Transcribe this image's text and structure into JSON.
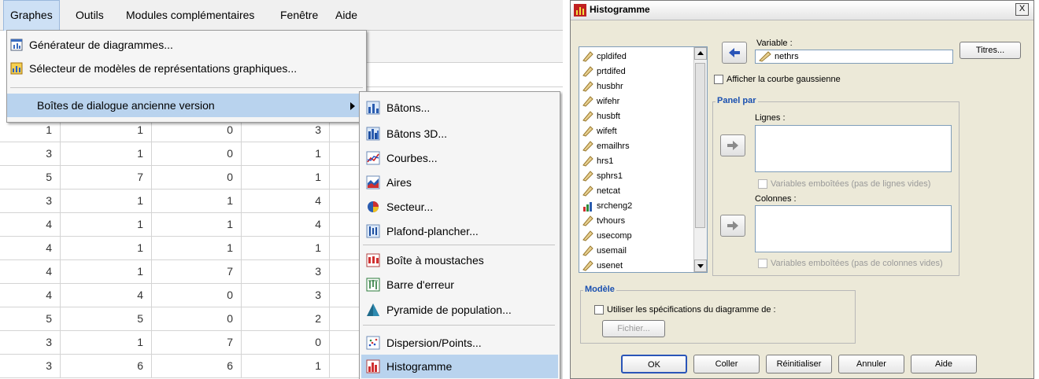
{
  "menubar": {
    "items": [
      {
        "label": "Graphes"
      },
      {
        "label": "Outils"
      },
      {
        "label": "Modules complémentaires"
      },
      {
        "label": "Fenêtre"
      },
      {
        "label": "Aide"
      }
    ]
  },
  "graph_menu": {
    "items": [
      {
        "label": "Générateur de diagrammes...",
        "icon": "chart-builder-icon"
      },
      {
        "label": "Sélecteur de modèles de représentations graphiques...",
        "icon": "template-chooser-icon"
      },
      {
        "label": "Boîtes de dialogue ancienne version",
        "icon": ""
      }
    ]
  },
  "sub_menu": {
    "items": [
      {
        "label": "Bâtons...",
        "icon": "bar-chart-icon"
      },
      {
        "label": "Bâtons 3D...",
        "icon": "bar-3d-icon"
      },
      {
        "label": "Courbes...",
        "icon": "line-chart-icon"
      },
      {
        "label": "Aires",
        "icon": "area-chart-icon"
      },
      {
        "label": "Secteur...",
        "icon": "pie-chart-icon"
      },
      {
        "label": "Plafond-plancher...",
        "icon": "high-low-icon"
      },
      {
        "label": "Boîte à moustaches",
        "icon": "boxplot-icon"
      },
      {
        "label": "Barre d'erreur",
        "icon": "error-bar-icon"
      },
      {
        "label": "Pyramide de population...",
        "icon": "population-pyramid-icon"
      },
      {
        "label": "Dispersion/Points...",
        "icon": "scatter-icon"
      },
      {
        "label": "Histogramme",
        "icon": "histogram-icon"
      }
    ],
    "selected": "Histogramme"
  },
  "grid": {
    "rows": [
      [
        "1",
        "1",
        "0",
        "3"
      ],
      [
        "3",
        "1",
        "0",
        "1"
      ],
      [
        "5",
        "7",
        "0",
        "1"
      ],
      [
        "3",
        "1",
        "1",
        "4"
      ],
      [
        "4",
        "1",
        "1",
        "4"
      ],
      [
        "4",
        "1",
        "1",
        "1"
      ],
      [
        "4",
        "1",
        "7",
        "3"
      ],
      [
        "4",
        "4",
        "0",
        "3"
      ],
      [
        "5",
        "5",
        "0",
        "2"
      ],
      [
        "3",
        "1",
        "7",
        "0"
      ],
      [
        "3",
        "6",
        "6",
        "1"
      ]
    ]
  },
  "dialog": {
    "title": "Histogramme",
    "close": "X",
    "variables": [
      "cpldifed",
      "prtdifed",
      "husbhr",
      "wifehr",
      "husbft",
      "wifeft",
      "emailhrs",
      "hrs1",
      "sphrs1",
      "netcat",
      "srcheng2",
      "tvhours",
      "usecomp",
      "usemail",
      "usenet"
    ],
    "variable_label": "Variable :",
    "variable_value": "nethrs",
    "titles_button": "Titres...",
    "normal_curve_label": "Afficher la courbe gaussienne",
    "panel_title": "Panel par",
    "rows_label": "Lignes :",
    "rows_nested_label": "Variables emboîtées (pas de lignes vides)",
    "cols_label": "Colonnes :",
    "cols_nested_label": "Variables emboîtées (pas de colonnes vides)",
    "model_title": "Modèle",
    "model_checkbox_label": "Utiliser les spécifications du diagramme de :",
    "file_button": "Fichier...",
    "ok": "OK",
    "paste": "Coller",
    "reset": "Réinitialiser",
    "cancel": "Annuler",
    "help": "Aide"
  },
  "colors": {
    "highlight": "#b9d3ee",
    "dialog_bg": "#ece9d8",
    "group_title": "#1a50b0"
  }
}
